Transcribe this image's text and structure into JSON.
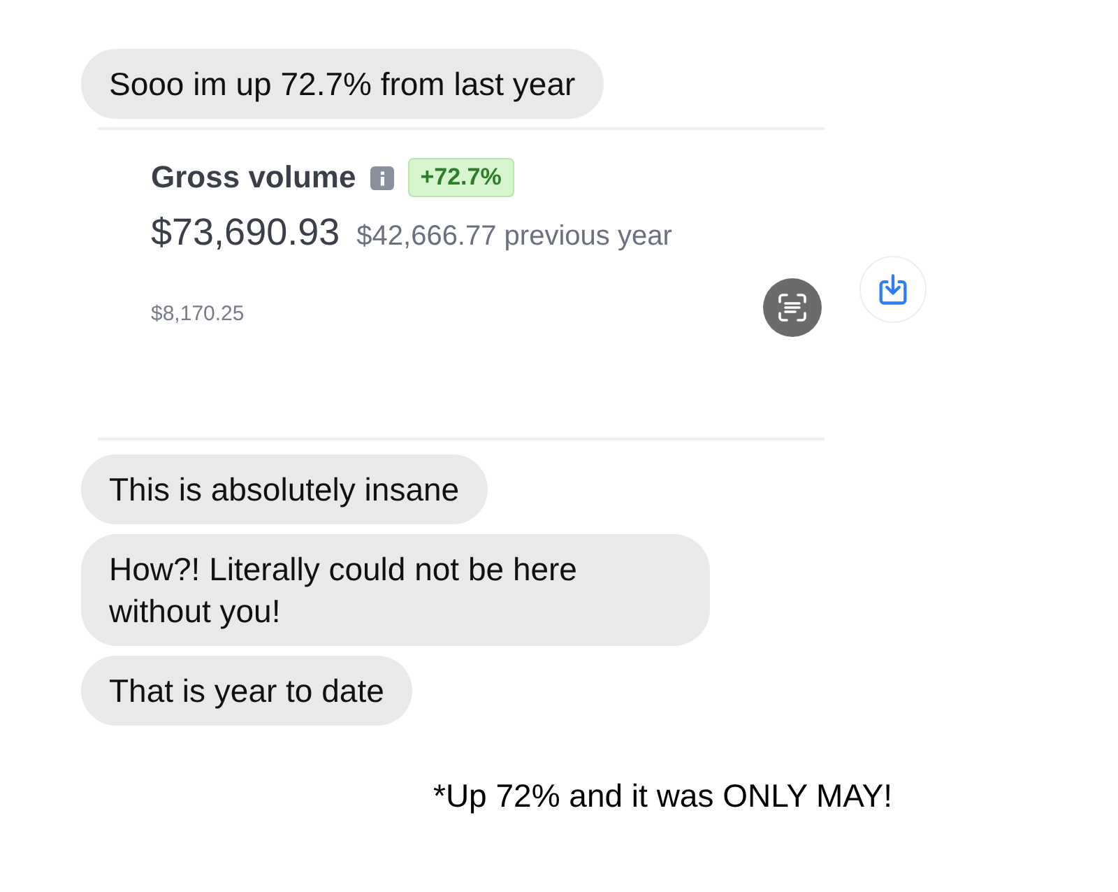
{
  "first_message": {
    "text": "Sooo im up 72.7% from last year"
  },
  "card": {
    "title": "Gross volume",
    "change": "+72.7%",
    "amount": "$73,690.93",
    "previous": "$42,666.77 previous year",
    "footer_value": "$8,170.25"
  },
  "messages": [
    {
      "text": "This is absolutely insane"
    },
    {
      "text": "How?! Literally could not be here without you!"
    },
    {
      "text": "That is year to date"
    }
  ],
  "caption": "*Up 72% and it was ONLY MAY!"
}
